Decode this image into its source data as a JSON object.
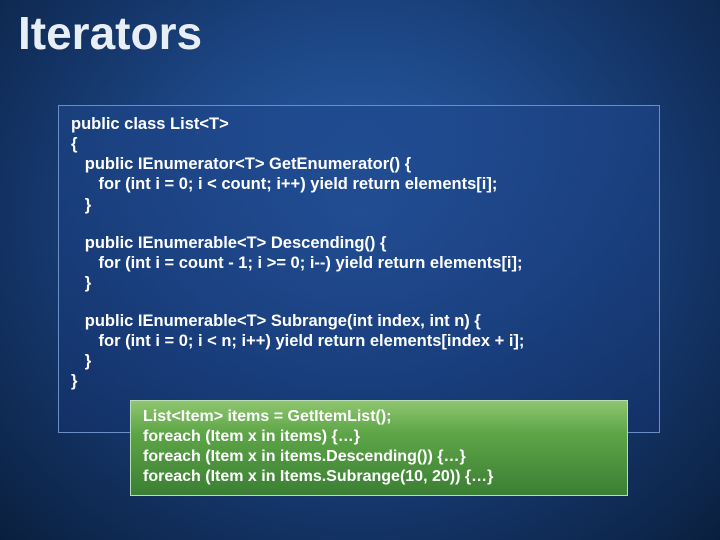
{
  "title": "Iterators",
  "code": {
    "l1": "public class List<T>",
    "l2": "{",
    "l3": "   public IEnumerator<T> GetEnumerator() {",
    "l4": "      for (int i = 0; i < count; i++) yield return elements[i];",
    "l5": "   }",
    "l6": "   public IEnumerable<T> Descending() {",
    "l7": "      for (int i = count - 1; i >= 0; i--) yield return elements[i];",
    "l8": "   }",
    "l9": "   public IEnumerable<T> Subrange(int index, int n) {",
    "l10": "      for (int i = 0; i < n; i++) yield return elements[index + i];",
    "l11": "   }",
    "l12": "}"
  },
  "snippet": {
    "s1": "List<Item> items = GetItemList();",
    "s2": "foreach (Item x in items) {…}",
    "s3": "foreach (Item x in items.Descending()) {…}",
    "s4": "foreach (Item x in Items.Subrange(10, 20)) {…}"
  }
}
